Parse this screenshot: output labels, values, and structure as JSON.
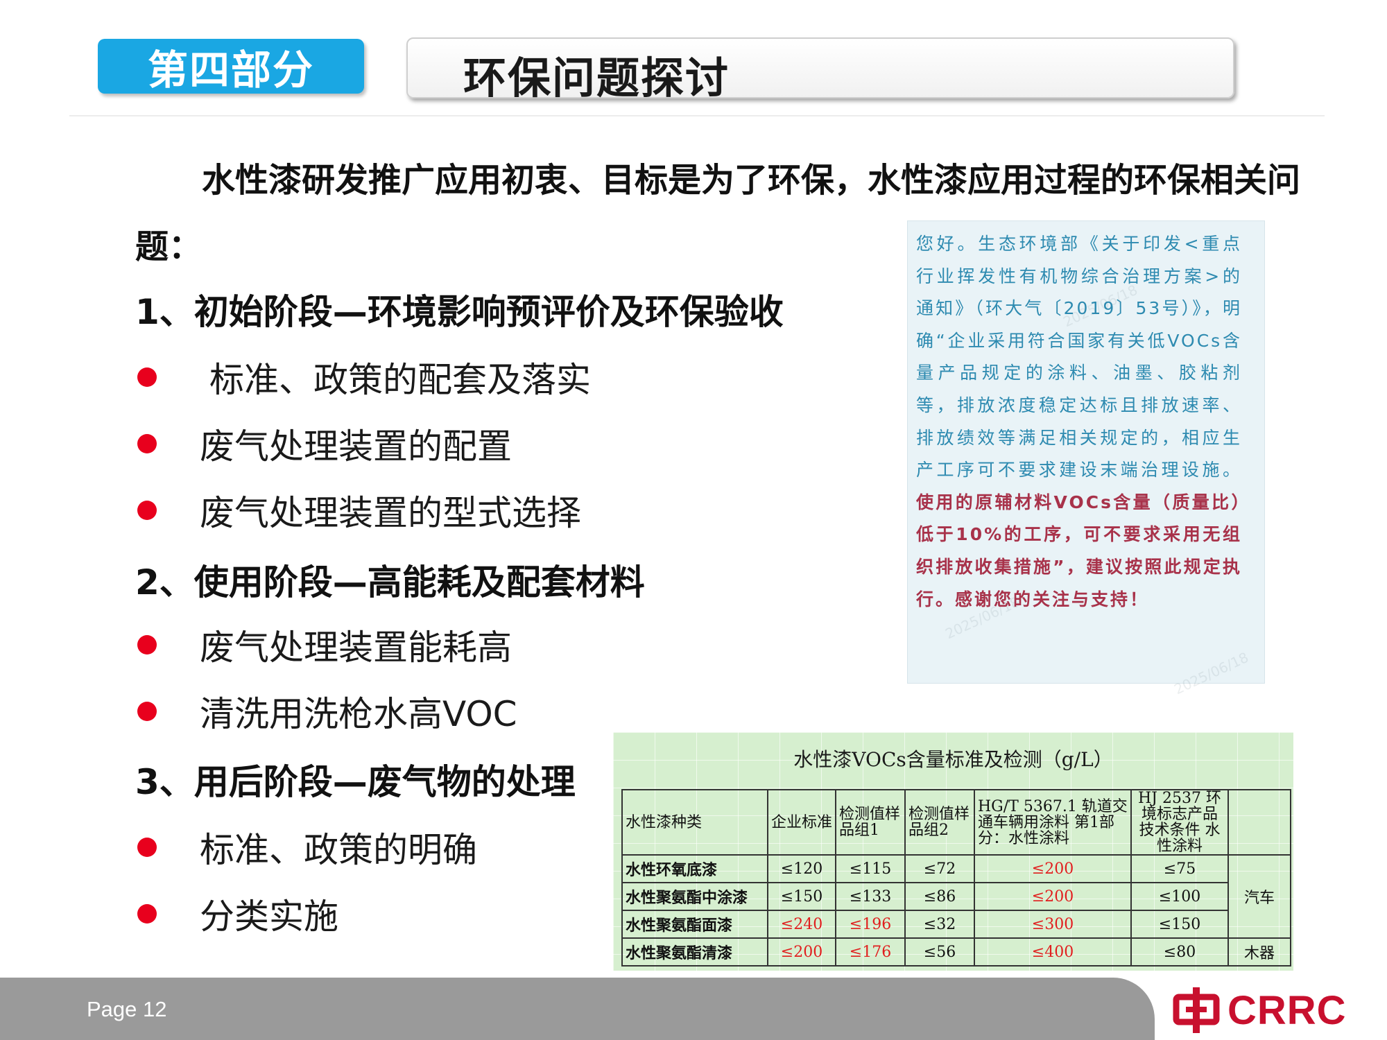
{
  "header": {
    "section_label": "第四部分",
    "title": "环保问题探讨"
  },
  "intro": "水性漆研发推广应用初衷、目标是为了环保，水性漆应用过程的环保相关问题：",
  "sections": [
    {
      "heading": "1、初始阶段—环境影响预评价及环保验收",
      "bullets": [
        "标准、政策的配套及落实",
        "废气处理装置的配置",
        "废气处理装置的型式选择"
      ]
    },
    {
      "heading": "2、使用阶段—高能耗及配套材料",
      "bullets": [
        "废气处理装置能耗高",
        "清洗用洗枪水高VOC"
      ]
    },
    {
      "heading": "3、用后阶段—废气物的处理",
      "bullets": [
        "标准、政策的明确",
        "分类实施"
      ]
    }
  ],
  "notice": {
    "text_plain": "您好。生态环境部《关于印发<重点行业挥发性有机物综合治理方案>的通知》（环大气〔2019〕53号）》，明确“企业采用符合国家有关低VOCs含量产品规定的涂料、油墨、胶粘剂等，排放浓度稳定达标且排放速率、排放绩效等满足相关规定的，相应生产工序可不要求建设末端治理设施。",
    "text_emphasis": "使用的原辅材料VOCs含量（质量比）低于10%的工序，可不要求采用无组织排放收集措施”，建议按照此规定执",
    "text_end": "行。感谢您的关注与支持！"
  },
  "table": {
    "title": "水性漆VOCs含量标准及检测（g/L）",
    "headers": [
      "水性漆种类",
      "企业标准",
      "检测值样品组1",
      "检测值样品组2",
      "HG/T 5367.1 轨道交通车辆用涂料 第1部分：水性涂料",
      "HJ 2537 环境标志产品技术条件 水性涂料",
      ""
    ],
    "rows": [
      {
        "name": "水性环氧底漆",
        "std": "≤120",
        "s1": "≤115",
        "s2": "≤72",
        "hg": "≤200",
        "hj": "≤75"
      },
      {
        "name": "水性聚氨酯中涂漆",
        "std": "≤150",
        "s1": "≤133",
        "s2": "≤86",
        "hg": "≤200",
        "hj": "≤100"
      },
      {
        "name": "水性聚氨酯面漆",
        "std": "≤240",
        "s1": "≤196",
        "s2": "≤32",
        "hg": "≤300",
        "hj": "≤150"
      },
      {
        "name": "水性聚氨酯清漆",
        "std": "≤200",
        "s1": "≤176",
        "s2": "≤56",
        "hg": "≤400",
        "hj": "≤80"
      }
    ],
    "category_car": "汽车",
    "category_wood": "木器"
  },
  "footer": {
    "page": "Page 12",
    "logo_text": "CRRC"
  },
  "colors": {
    "accent_blue": "#1aa7e3",
    "bullet_red": "#e8001d",
    "notice_text": "#2d8ab0",
    "notice_emphasis": "#a8324a",
    "logo_red": "#c8102e",
    "footer_gray": "#9a9a9a"
  }
}
